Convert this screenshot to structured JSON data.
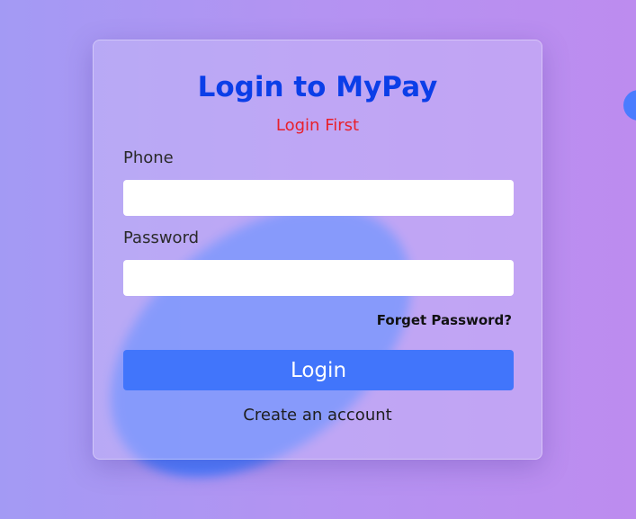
{
  "login_form": {
    "title": "Login to MyPay",
    "error_message": "Login First",
    "phone_label": "Phone",
    "phone_value": "",
    "password_label": "Password",
    "password_value": "",
    "forget_password_link": "Forget Password?",
    "login_button": "Login",
    "create_account_link": "Create an account"
  },
  "colors": {
    "title": "#0b3ee8",
    "error": "#e8202b",
    "button": "#4175fb",
    "background_start": "#a39af4",
    "background_end": "#bd8cef",
    "blob": "#4a7cff"
  }
}
